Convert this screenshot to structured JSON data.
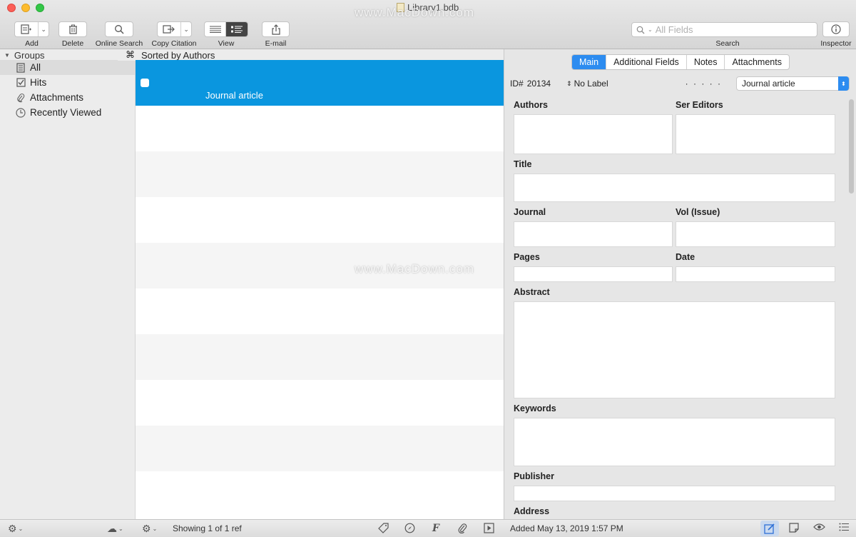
{
  "window": {
    "title": "Library1.bdb"
  },
  "toolbar": {
    "add": "Add",
    "delete": "Delete",
    "online_search": "Online Search",
    "copy_citation": "Copy Citation",
    "view": "View",
    "email": "E-mail",
    "search_placeholder": "All Fields",
    "search_label": "Search",
    "inspector": "Inspector"
  },
  "sidebar": {
    "header": "Groups",
    "items": [
      {
        "label": "All",
        "icon": "library-icon",
        "selected": true
      },
      {
        "label": "Hits",
        "icon": "checkbox-icon",
        "selected": false
      },
      {
        "label": "Attachments",
        "icon": "paperclip-icon",
        "selected": false
      },
      {
        "label": "Recently Viewed",
        "icon": "clock-icon",
        "selected": false
      }
    ]
  },
  "list": {
    "sort_label": "Sorted by Authors",
    "rows": [
      {
        "type": "Journal article",
        "selected": true
      }
    ]
  },
  "inspector": {
    "tabs": [
      "Main",
      "Additional Fields",
      "Notes",
      "Attachments"
    ],
    "active_tab": "Main",
    "id_label": "ID#",
    "id_value": "20134",
    "label": "No Label",
    "rating": "· · · · ·",
    "ref_type": "Journal article",
    "fields": {
      "authors": "Authors",
      "ser_editors": "Ser Editors",
      "title": "Title",
      "journal": "Journal",
      "vol_issue": "Vol (Issue)",
      "pages": "Pages",
      "date": "Date",
      "abstract": "Abstract",
      "keywords": "Keywords",
      "publisher": "Publisher",
      "address": "Address"
    }
  },
  "status": {
    "showing": "Showing 1 of 1 ref",
    "added": "Added May 13, 2019 1:57 PM"
  },
  "watermark": "www.MacDown.com",
  "colors": {
    "selection": "#0a96df",
    "accent": "#2d8cf0"
  }
}
